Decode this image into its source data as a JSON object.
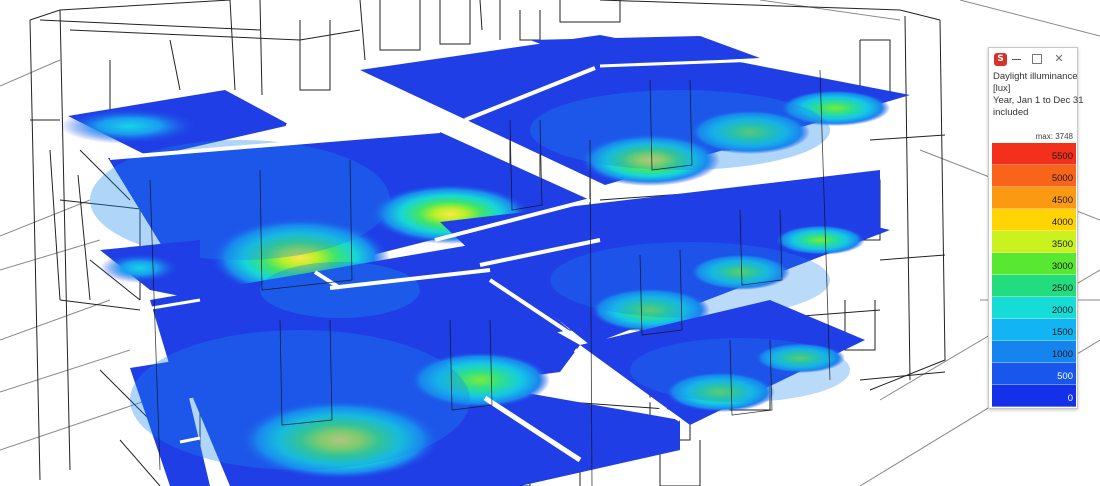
{
  "legend": {
    "app_icon": "sketchup-icon",
    "title_line1": "Daylight illuminance",
    "title_line2": "[lux]",
    "title_line3": "Year, Jan 1 to Dec 31",
    "title_line4": "included",
    "max_label": "max: 3748",
    "bands": [
      {
        "label": "5500",
        "color": "#f2301c"
      },
      {
        "label": "5000",
        "color": "#f8641a"
      },
      {
        "label": "4500",
        "color": "#fb9a12"
      },
      {
        "label": "4000",
        "color": "#ffd400"
      },
      {
        "label": "3500",
        "color": "#c9f21e"
      },
      {
        "label": "3000",
        "color": "#58e832"
      },
      {
        "label": "2500",
        "color": "#22dc7e"
      },
      {
        "label": "2000",
        "color": "#16dcd8"
      },
      {
        "label": "1500",
        "color": "#12b4f4"
      },
      {
        "label": "1000",
        "color": "#1684ee"
      },
      {
        "label": "500",
        "color": "#1856ec"
      },
      {
        "label": "0",
        "color": "#1430e8"
      }
    ]
  },
  "scene": {
    "background": "#ffffff",
    "floor_base_color": "#1f3ee6",
    "hotspot_colors": [
      "#1684ee",
      "#16dcd8",
      "#22dc7e",
      "#58e832",
      "#c9f21e",
      "#ffd400"
    ]
  }
}
